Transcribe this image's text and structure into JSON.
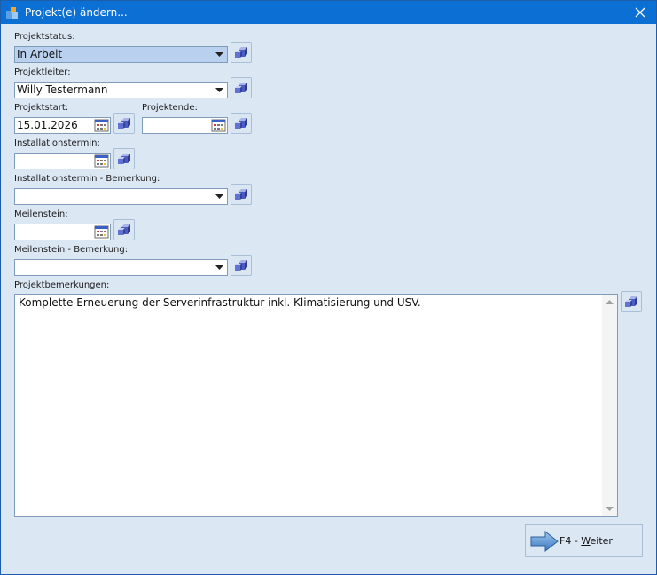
{
  "window": {
    "title": "Projekt(e) ändern..."
  },
  "fields": {
    "projektstatus": {
      "label": "Projektstatus:",
      "value": "In Arbeit"
    },
    "projektleiter": {
      "label": "Projektleiter:",
      "value": "Willy Testermann"
    },
    "projektstart": {
      "label": "Projektstart:",
      "value": "15.01.2026"
    },
    "projektende": {
      "label": "Projektende:",
      "value": ""
    },
    "installationstermin": {
      "label": "Installationstermin:",
      "value": ""
    },
    "installationstermin_bemerkung": {
      "label": "Installationstermin - Bemerkung:",
      "value": ""
    },
    "meilenstein": {
      "label": "Meilenstein:",
      "value": ""
    },
    "meilenstein_bemerkung": {
      "label": "Meilenstein - Bemerkung:",
      "value": ""
    },
    "projektbemerkungen": {
      "label": "Projektbemerkungen:",
      "value": "Komplette Erneuerung der Serverinfrastruktur inkl. Klimatisierung und USV."
    }
  },
  "next_button": {
    "prefix": "F4 - ",
    "mnemonic": "W",
    "rest": "eiter"
  },
  "icons": {
    "app": "app-icon",
    "close": "close-icon",
    "dropdown": "chevron-down-icon",
    "calendar": "calendar-icon",
    "side_action": "copy-cube-icon",
    "next": "arrow-right-icon"
  },
  "colors": {
    "titlebar": "#0b6fd4",
    "dialog_bg": "#dce7f4",
    "selection": "#b9d1ef",
    "border": "#7f9db9"
  }
}
